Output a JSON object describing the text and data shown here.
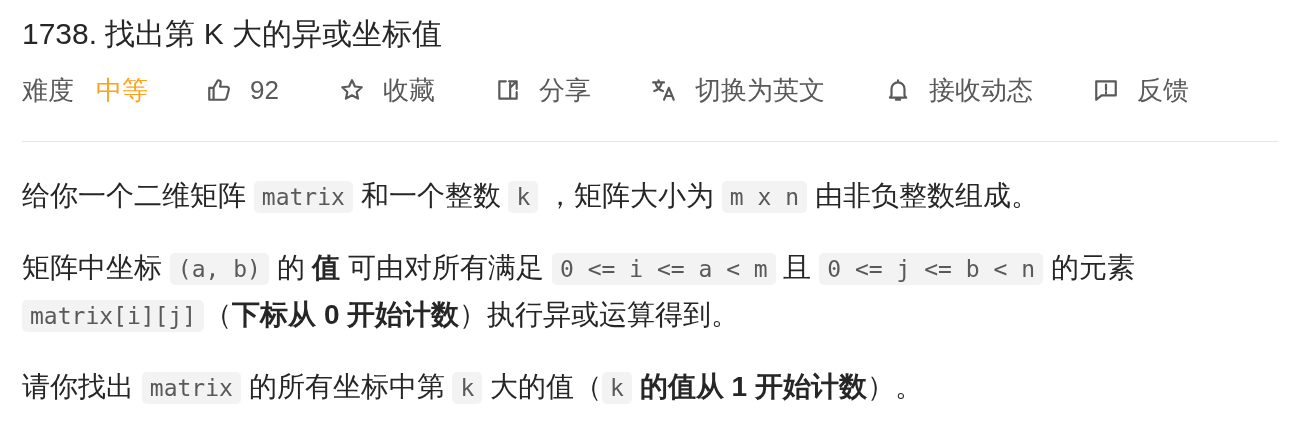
{
  "title": "1738. 找出第 K 大的异或坐标值",
  "toolbar": {
    "difficulty_label": "难度",
    "difficulty": "中等",
    "actions": [
      {
        "kind": "like",
        "label": "92"
      },
      {
        "kind": "star",
        "label": "收藏"
      },
      {
        "kind": "share",
        "label": "分享"
      },
      {
        "kind": "translate",
        "label": "切换为英文"
      },
      {
        "kind": "bell",
        "label": "接收动态"
      },
      {
        "kind": "feedback",
        "label": "反馈"
      }
    ]
  },
  "paragraphs": [
    [
      {
        "kind": "text",
        "text": "给你一个二维矩阵 "
      },
      {
        "kind": "code",
        "text": "matrix"
      },
      {
        "kind": "text",
        "text": " 和一个整数 "
      },
      {
        "kind": "code",
        "text": "k"
      },
      {
        "kind": "text",
        "text": " ，矩阵大小为 "
      },
      {
        "kind": "code",
        "text": "m x n"
      },
      {
        "kind": "text",
        "text": " 由非负整数组成。"
      }
    ],
    [
      {
        "kind": "text",
        "text": "矩阵中坐标 "
      },
      {
        "kind": "code",
        "text": "(a, b)"
      },
      {
        "kind": "text",
        "text": " 的 "
      },
      {
        "kind": "bold",
        "text": "值"
      },
      {
        "kind": "text",
        "text": " 可由对所有满足 "
      },
      {
        "kind": "code",
        "text": "0 <= i <= a < m"
      },
      {
        "kind": "text",
        "text": " 且 "
      },
      {
        "kind": "code",
        "text": "0 <= j <= b < n"
      },
      {
        "kind": "text",
        "text": " 的元素 "
      },
      {
        "kind": "code",
        "text": "matrix[i][j]"
      },
      {
        "kind": "text",
        "text": "（"
      },
      {
        "kind": "bold",
        "text": "下标从 0 开始计数"
      },
      {
        "kind": "text",
        "text": "）执行异或运算得到。"
      }
    ],
    [
      {
        "kind": "text",
        "text": "请你找出 "
      },
      {
        "kind": "code",
        "text": "matrix"
      },
      {
        "kind": "text",
        "text": " 的所有坐标中第 "
      },
      {
        "kind": "code",
        "text": "k"
      },
      {
        "kind": "text",
        "text": " 大的值（"
      },
      {
        "kind": "code",
        "text": "k"
      },
      {
        "kind": "bold",
        "text": " 的值从 1 开始计数"
      },
      {
        "kind": "text",
        "text": "）。"
      }
    ]
  ]
}
